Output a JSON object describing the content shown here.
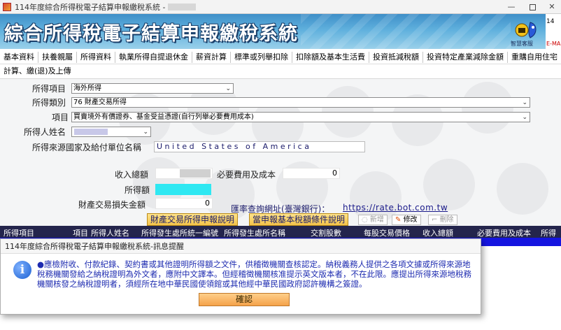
{
  "window": {
    "title": "114年度綜合所得稅電子結算申報繳稅系統 -",
    "minimize": "—",
    "close": "✕"
  },
  "banner": {
    "title": "綜合所得稅電子結算申報繳稅系統",
    "mascot_label": "智慧客服",
    "side_char": "14",
    "side_text": "E-MA"
  },
  "menu": {
    "row1": [
      "基本資料",
      "扶養親屬",
      "所得資料",
      "執業所得自提退休金",
      "薪資計算",
      "標準或列舉扣除",
      "扣除額及基本生活費",
      "投資抵減稅額",
      "投資特定產業減除金額",
      "重購自用住宅"
    ],
    "row2": [
      "計算、繳(退)及上傳"
    ]
  },
  "form": {
    "income_item_label": "所得項目",
    "income_item_value": "海外所得",
    "income_category_label": "所得類別",
    "income_category_value": "76 財產交易所得",
    "item_label": "項目",
    "item_value": "買賣境外有價證券、基金受益憑證(自行列舉必要費用成本)",
    "person_label": "所得人姓名",
    "source_label": "所得來源國家及給付單位名稱",
    "source_value": "United States of America",
    "total_income_label": "收入總額",
    "necessary_cost_label": "必要費用及成本",
    "necessary_cost_value": "0",
    "income_amount_label": "所得額",
    "loss_label": "財產交易損失金額",
    "loss_value": "0",
    "rate_label": "匯率查詢網址(臺灣銀行)：",
    "rate_url": "https://rate.bot.com.tw",
    "btn_explain": "財產交易所得申報說明",
    "btn_conditions": "當申報基本稅額條件說明",
    "btn_add": "新增",
    "btn_edit": "修改",
    "btn_delete": "刪除"
  },
  "table": {
    "headers": [
      "所得項目",
      "項目",
      "所得人姓名",
      "所得發生處所統一編號",
      "所得發生處所名稱",
      "交割股數",
      "每股交易價格",
      "收入總額",
      "必要費用及成本",
      "所得"
    ]
  },
  "modal": {
    "title": "114年度綜合所得稅電子結算申報繳稅系統-訊息提醒",
    "message": "●應檢附收、付款紀錄、契約書或其他證明所得額之文件，供稽徵機關查核認定。納稅義務人提供之各項文據或所得來源地稅務機關發給之納稅證明為外文者，應附中文譯本。但經稽徵機關核准提示英文版本者，不在此限。應提出所得來源地稅務機關核發之納稅證明者，須經所在地中華民國使領館或其他經中華民國政府認許機構之簽證。",
    "ok_label": "確認"
  },
  "colors": {
    "banner_top": "#3f8fc8",
    "table_header": "#24254c",
    "highlight_field": "#2fe8f2",
    "message_text": "#1d2bb0"
  }
}
